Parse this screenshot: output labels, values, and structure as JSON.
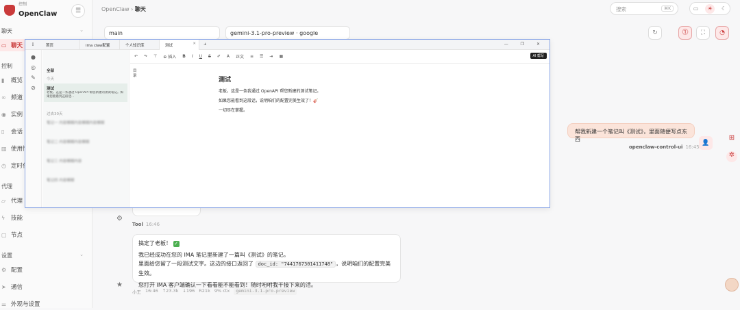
{
  "brand": {
    "sub": "控制",
    "name": "OpenClaw"
  },
  "sidebar": {
    "sections": [
      {
        "label": "聊天"
      },
      {
        "label": "控制"
      },
      {
        "label": "代理"
      },
      {
        "label": "设置"
      }
    ],
    "items": [
      {
        "label": "聊天",
        "icon": "chat-icon"
      },
      {
        "label": "概览",
        "icon": "chart-icon"
      },
      {
        "label": "频道",
        "icon": "link-icon"
      },
      {
        "label": "实例",
        "icon": "radio-icon"
      },
      {
        "label": "会话",
        "icon": "file-icon"
      },
      {
        "label": "使用情",
        "icon": "bar-icon"
      },
      {
        "label": "定时任",
        "icon": "clock-icon"
      },
      {
        "label": "代理",
        "icon": "folder-icon"
      },
      {
        "label": "技能",
        "icon": "bolt-icon"
      },
      {
        "label": "节点",
        "icon": "node-icon"
      },
      {
        "label": "配置",
        "icon": "gear-icon"
      },
      {
        "label": "通信",
        "icon": "send-icon"
      },
      {
        "label": "外观与设置",
        "icon": "sliders-icon"
      }
    ]
  },
  "topbar": {
    "crumb_root": "OpenClaw",
    "crumb_sep": "›",
    "crumb_current": "聊天",
    "search_placeholder": "搜索",
    "search_kbd": "⌘K"
  },
  "session": {
    "agent": "main",
    "model": "gemini-3.1-pro-preview · google"
  },
  "chat": {
    "user_message": "帮我新建一个笔记叫《测试》，里面随便写点东西",
    "user_name": "openclaw-control-ui",
    "user_time": "16:45",
    "tool_name": "Tool",
    "tool_time": "16:46",
    "reply_line1": "搞定了老板！",
    "reply_check": "✓",
    "reply_line2": "我已经成功在您的 IMA 笔记里新建了一篇叫《测试》的笔记。",
    "reply_line3a": "里面给您留了一段测试文字。这边的接口返回了",
    "reply_code": "doc_id: \"7441767301411748\"",
    "reply_line3b": "，说明咱们的配置完美生效。",
    "reply_line4": "您打开 IMA 客户端确认一下看看能不能看到！随时吩咐我干接下来的活。",
    "reply_name": "小王",
    "reply_time": "16:46",
    "reply_tokens": "↑23.3k",
    "reply_out": "↓196",
    "reply_cache": "R21k",
    "reply_ctx": "9% ctx",
    "reply_model": "gemini-3.1-pro-preview"
  },
  "window": {
    "tabs": [
      {
        "label": "首页"
      },
      {
        "label": "ima claw配置"
      },
      {
        "label": "个人知识库"
      },
      {
        "label": "测试"
      }
    ],
    "controls": "— ❐ ✕",
    "list_filter": "全部",
    "group_today": "今天",
    "group_past": "过去30天",
    "note_title": "测试",
    "note_preview_label": "测试",
    "note_preview": "老板，这是一条通过 OpenAPI 帮您新建的测试笔记。如果您能看到这段话…",
    "blur_rows": [
      "笔记一 内容模糊内容模糊内容模糊",
      "笔记二 内容模糊内容模糊",
      "笔记三 内容模糊内容",
      "笔记四 内容模糊"
    ],
    "toolbar": {
      "insert": "插入",
      "style": "正文",
      "ai": "AI 帮写"
    },
    "toc": "目录",
    "doc_title": "测试",
    "doc_p1": "老板，这是一条我通过 OpenAPI 帮您新建的测试笔记。",
    "doc_p2": "如果您能看到这段话，说明咱们的配置完美生效了！🎸",
    "doc_p3": "一切尽在掌握。"
  }
}
